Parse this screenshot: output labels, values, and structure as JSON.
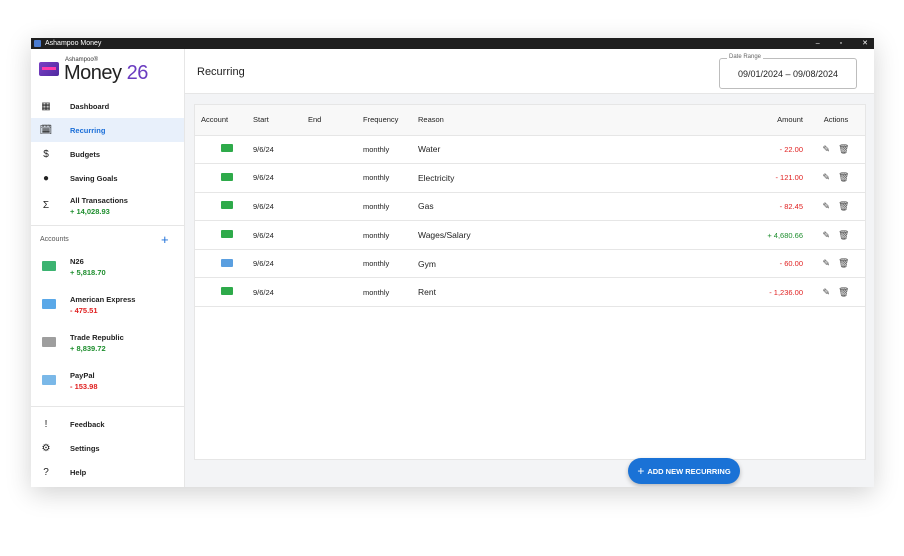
{
  "window": {
    "title": "Ashampoo Money",
    "controls": [
      "–",
      "▫",
      "✕"
    ]
  },
  "logo": {
    "small": "Ashampoo®",
    "big": "Money",
    "num": "26"
  },
  "nav": [
    {
      "label": "Dashboard",
      "icon": "dashboard-icon"
    },
    {
      "label": "Recurring",
      "icon": "calendar-icon",
      "active": true
    },
    {
      "label": "Budgets",
      "icon": "dollar-icon"
    },
    {
      "label": "Saving Goals",
      "icon": "piggy-bank-icon"
    },
    {
      "label": "All Transactions",
      "sub": "+ 14,028.93",
      "icon": "sigma-icon"
    }
  ],
  "accounts": {
    "label": "Accounts",
    "items": [
      {
        "name": "N26",
        "balance": "+ 5,818.70",
        "color": "#3cb371"
      },
      {
        "name": "American Express",
        "balance": "- 475.51",
        "color": "#5aa8e8"
      },
      {
        "name": "Trade Republic",
        "balance": "+ 8,839.72",
        "color": "#9e9e9e"
      },
      {
        "name": "PayPal",
        "balance": "- 153.98",
        "color": "#7ab8e8"
      }
    ]
  },
  "bottom_nav": [
    {
      "label": "Feedback",
      "icon": "feedback-icon"
    },
    {
      "label": "Settings",
      "icon": "gear-icon"
    },
    {
      "label": "Help",
      "icon": "help-icon"
    }
  ],
  "header": {
    "title": "Recurring"
  },
  "date_range": {
    "label": "Date Range",
    "value": "09/01/2024 – 09/08/2024"
  },
  "table": {
    "columns": [
      "Account",
      "Start",
      "End",
      "Frequency",
      "Reason",
      "Amount",
      "Actions"
    ],
    "rows": [
      {
        "start": "9/6/24",
        "end": "",
        "frequency": "monthly",
        "reason": "Water",
        "amount": "- 22.00",
        "color": "#2eaa4a"
      },
      {
        "start": "9/6/24",
        "end": "",
        "frequency": "monthly",
        "reason": "Electricity",
        "amount": "- 121.00",
        "color": "#2eaa4a"
      },
      {
        "start": "9/6/24",
        "end": "",
        "frequency": "monthly",
        "reason": "Gas",
        "amount": "- 82.45",
        "color": "#2eaa4a"
      },
      {
        "start": "9/6/24",
        "end": "",
        "frequency": "monthly",
        "reason": "Wages/Salary",
        "amount": "+ 4,680.66",
        "color": "#2eaa4a"
      },
      {
        "start": "9/6/24",
        "end": "",
        "frequency": "monthly",
        "reason": "Gym",
        "amount": "- 60.00",
        "color": "#5a9fe0"
      },
      {
        "start": "9/6/24",
        "end": "",
        "frequency": "monthly",
        "reason": "Rent",
        "amount": "- 1,236.00",
        "color": "#2eaa4a"
      }
    ]
  },
  "fab": {
    "label": "ADD NEW RECURRING"
  }
}
